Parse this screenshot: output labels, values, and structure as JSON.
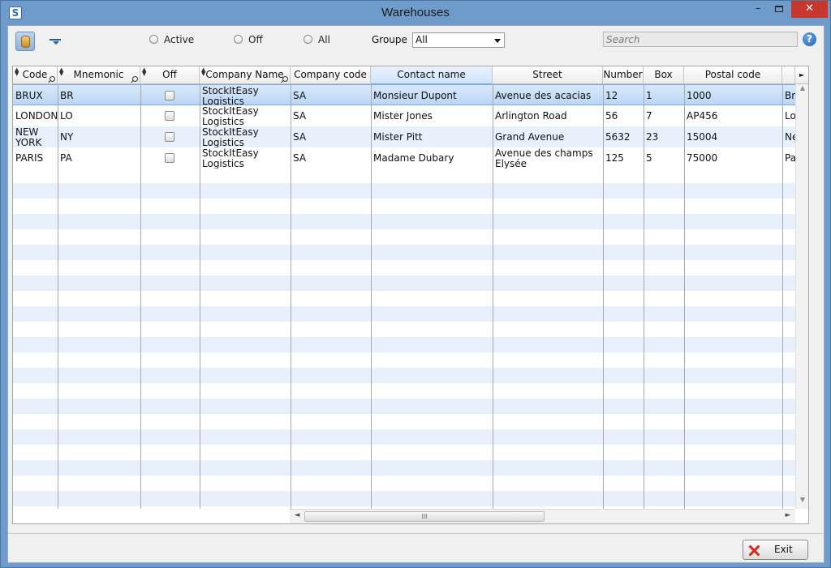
{
  "window": {
    "title": "Warehouses",
    "app_icon": "S",
    "minimize": "–",
    "close": "✕"
  },
  "toolbar": {
    "filters": [
      {
        "label": "Active"
      },
      {
        "label": "Off"
      },
      {
        "label": "All"
      }
    ],
    "groupe_label": "Groupe",
    "groupe_value": "All",
    "search_placeholder": "Search",
    "help": "?"
  },
  "grid": {
    "columns": [
      {
        "label": "Code"
      },
      {
        "label": "Mnemonic"
      },
      {
        "label": "Off"
      },
      {
        "label": "Company Name"
      },
      {
        "label": "Company code"
      },
      {
        "label": "Contact name"
      },
      {
        "label": "Street"
      },
      {
        "label": "Number"
      },
      {
        "label": "Box"
      },
      {
        "label": "Postal code"
      }
    ],
    "rows": [
      {
        "code": "BRUX",
        "mnemonic": "BR",
        "off": false,
        "company_name": "StockItEasy Logistics",
        "company_code": "SA",
        "contact": "Monsieur Dupont",
        "street": "Avenue des acacias",
        "number": "12",
        "box": "1",
        "postal": "1000",
        "extra": "Br"
      },
      {
        "code": "LONDON",
        "mnemonic": "LO",
        "off": false,
        "company_name": "StockItEasy Logistics",
        "company_code": "SA",
        "contact": "Mister Jones",
        "street": "Arlington Road",
        "number": "56",
        "box": "7",
        "postal": "AP456",
        "extra": "Lo"
      },
      {
        "code": "NEW YORK",
        "mnemonic": "NY",
        "off": false,
        "company_name": "StockItEasy Logistics",
        "company_code": "SA",
        "contact": "Mister Pitt",
        "street": "Grand Avenue",
        "number": "5632",
        "box": "23",
        "postal": "15004",
        "extra": "Ne"
      },
      {
        "code": "PARIS",
        "mnemonic": "PA",
        "off": false,
        "company_name": "StockItEasy Logistics",
        "company_code": "SA",
        "contact": "Madame Dubary",
        "street": "Avenue des champs Elysée",
        "number": "125",
        "box": "5",
        "postal": "75000",
        "extra": "Pa"
      }
    ],
    "hscroll_grip": "III"
  },
  "footer": {
    "exit_label": "Exit"
  },
  "colors": {
    "selection": "#bcd6f6",
    "stripe": "#e7f0fb",
    "titlebar": "#6f9bca",
    "close": "#c7372c",
    "exit_icon": "#d42a1e"
  }
}
